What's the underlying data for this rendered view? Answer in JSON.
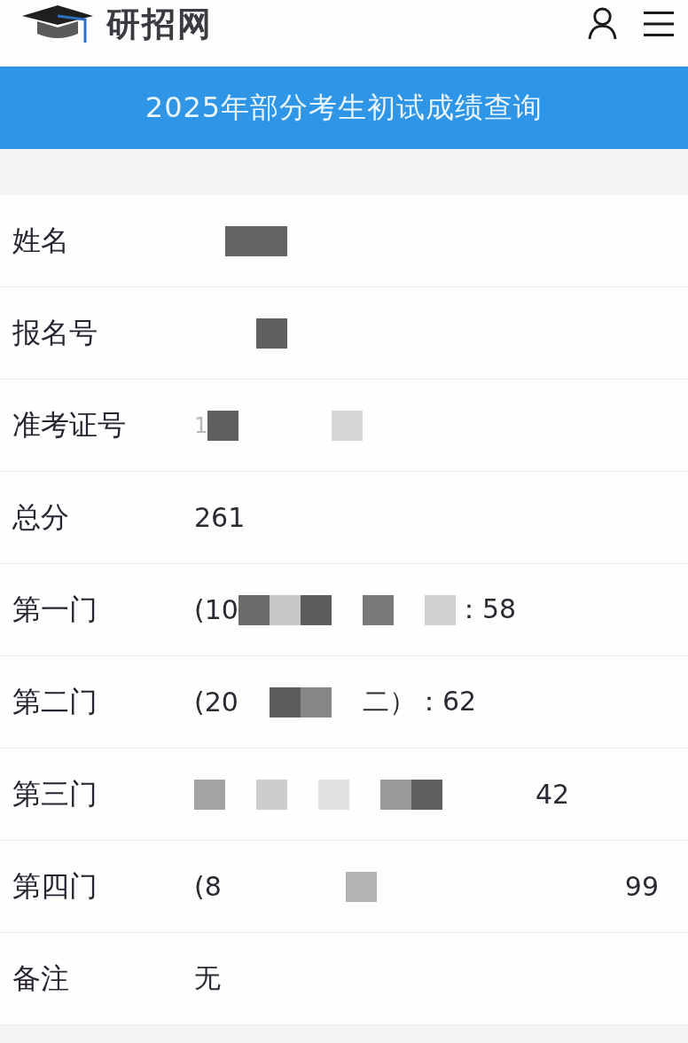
{
  "header": {
    "logo": "研招网"
  },
  "banner": {
    "title": "2025年部分考生初试成绩查询"
  },
  "rows": [
    {
      "label": "姓名",
      "value": [
        {
          "kind": "gap"
        },
        {
          "kind": "block",
          "color": "#636363"
        },
        {
          "kind": "block",
          "color": "#636363"
        }
      ]
    },
    {
      "label": "报名号",
      "value": [
        {
          "kind": "gap"
        },
        {
          "kind": "gap"
        },
        {
          "kind": "block",
          "color": "#606060"
        }
      ]
    },
    {
      "label": "准考证号",
      "value": [
        {
          "kind": "text",
          "text": "1",
          "faded": true
        },
        {
          "kind": "block",
          "color": "#5f5f5f"
        },
        {
          "kind": "gap"
        },
        {
          "kind": "gap"
        },
        {
          "kind": "gap"
        },
        {
          "kind": "block",
          "color": "#d6d6d6"
        }
      ]
    },
    {
      "label": "总分",
      "value": [
        {
          "kind": "text",
          "text": "261",
          "faded": false
        }
      ]
    },
    {
      "label": "第一门",
      "value": [
        {
          "kind": "text",
          "text": "(10",
          "faded": false
        },
        {
          "kind": "block",
          "color": "#6b6b6b"
        },
        {
          "kind": "block",
          "color": "#c8c8c8"
        },
        {
          "kind": "block",
          "color": "#5d5d5d"
        },
        {
          "kind": "gap"
        },
        {
          "kind": "block",
          "color": "#787878"
        },
        {
          "kind": "gap"
        },
        {
          "kind": "block",
          "color": "#d0d0d0"
        },
        {
          "kind": "text",
          "text": "：58",
          "faded": false
        }
      ]
    },
    {
      "label": "第二门",
      "value": [
        {
          "kind": "text",
          "text": "(20",
          "faded": false
        },
        {
          "kind": "gap"
        },
        {
          "kind": "block",
          "color": "#5c5c5c"
        },
        {
          "kind": "block",
          "color": "#868686"
        },
        {
          "kind": "gap"
        },
        {
          "kind": "text",
          "text": "二）：62",
          "faded": false
        }
      ]
    },
    {
      "label": "第三门",
      "value": [
        {
          "kind": "block",
          "color": "#a3a3a3"
        },
        {
          "kind": "gap"
        },
        {
          "kind": "block",
          "color": "#cdcdcd"
        },
        {
          "kind": "gap"
        },
        {
          "kind": "block",
          "color": "#e2e2e2"
        },
        {
          "kind": "gap"
        },
        {
          "kind": "block",
          "color": "#9a9a9a"
        },
        {
          "kind": "block",
          "color": "#606060"
        },
        {
          "kind": "gap"
        },
        {
          "kind": "gap"
        },
        {
          "kind": "gap"
        },
        {
          "kind": "text",
          "text": "42",
          "faded": false
        }
      ]
    },
    {
      "label": "第四门",
      "value": [
        {
          "kind": "text",
          "text": "(8",
          "faded": false
        },
        {
          "kind": "gap"
        },
        {
          "kind": "gap"
        },
        {
          "kind": "gap"
        },
        {
          "kind": "gap"
        },
        {
          "kind": "block",
          "color": "#b3b3b3"
        },
        {
          "kind": "gap"
        },
        {
          "kind": "gap"
        },
        {
          "kind": "gap"
        },
        {
          "kind": "gap"
        },
        {
          "kind": "gap"
        },
        {
          "kind": "gap"
        },
        {
          "kind": "gap"
        },
        {
          "kind": "gap"
        },
        {
          "kind": "text",
          "text": "99",
          "faded": false
        }
      ]
    },
    {
      "label": "备注",
      "value": [
        {
          "kind": "text",
          "text": "无",
          "faded": false
        }
      ]
    }
  ]
}
